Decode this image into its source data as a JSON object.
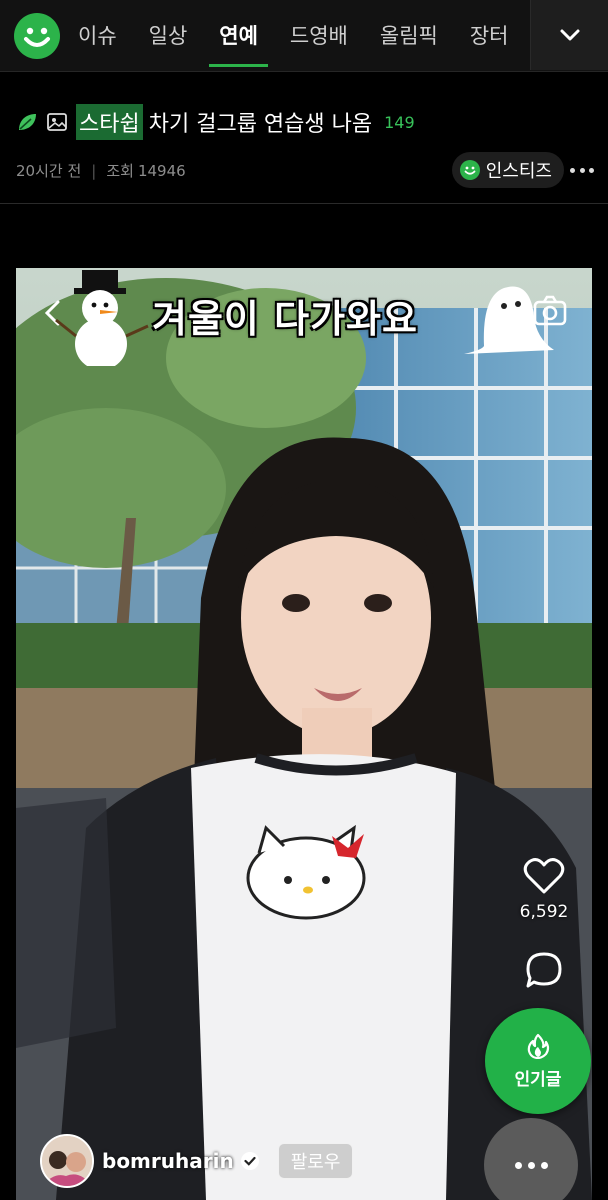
{
  "nav": {
    "logo_icon": "smile-logo-icon",
    "tabs": [
      {
        "label": "이슈",
        "active": false
      },
      {
        "label": "일상",
        "active": false
      },
      {
        "label": "연예",
        "active": true
      },
      {
        "label": "드영배",
        "active": false
      },
      {
        "label": "올림픽",
        "active": false
      },
      {
        "label": "장터",
        "active": false
      }
    ],
    "more_icon": "chevron-down-icon",
    "accent_color": "#2cb34a"
  },
  "post": {
    "title_highlight": "스타쉽",
    "title_rest": "차기 걸그룹 연습생 나옴",
    "comment_count": "149",
    "time_ago": "20시간 전",
    "views_label": "조회",
    "views": "14946",
    "board_chip": "인스티즈"
  },
  "video": {
    "caption": "겨울이 다가와요",
    "like_count": "6,592",
    "username": "bomruharin",
    "follow_label": "팔로우",
    "popular_label": "인기글"
  }
}
